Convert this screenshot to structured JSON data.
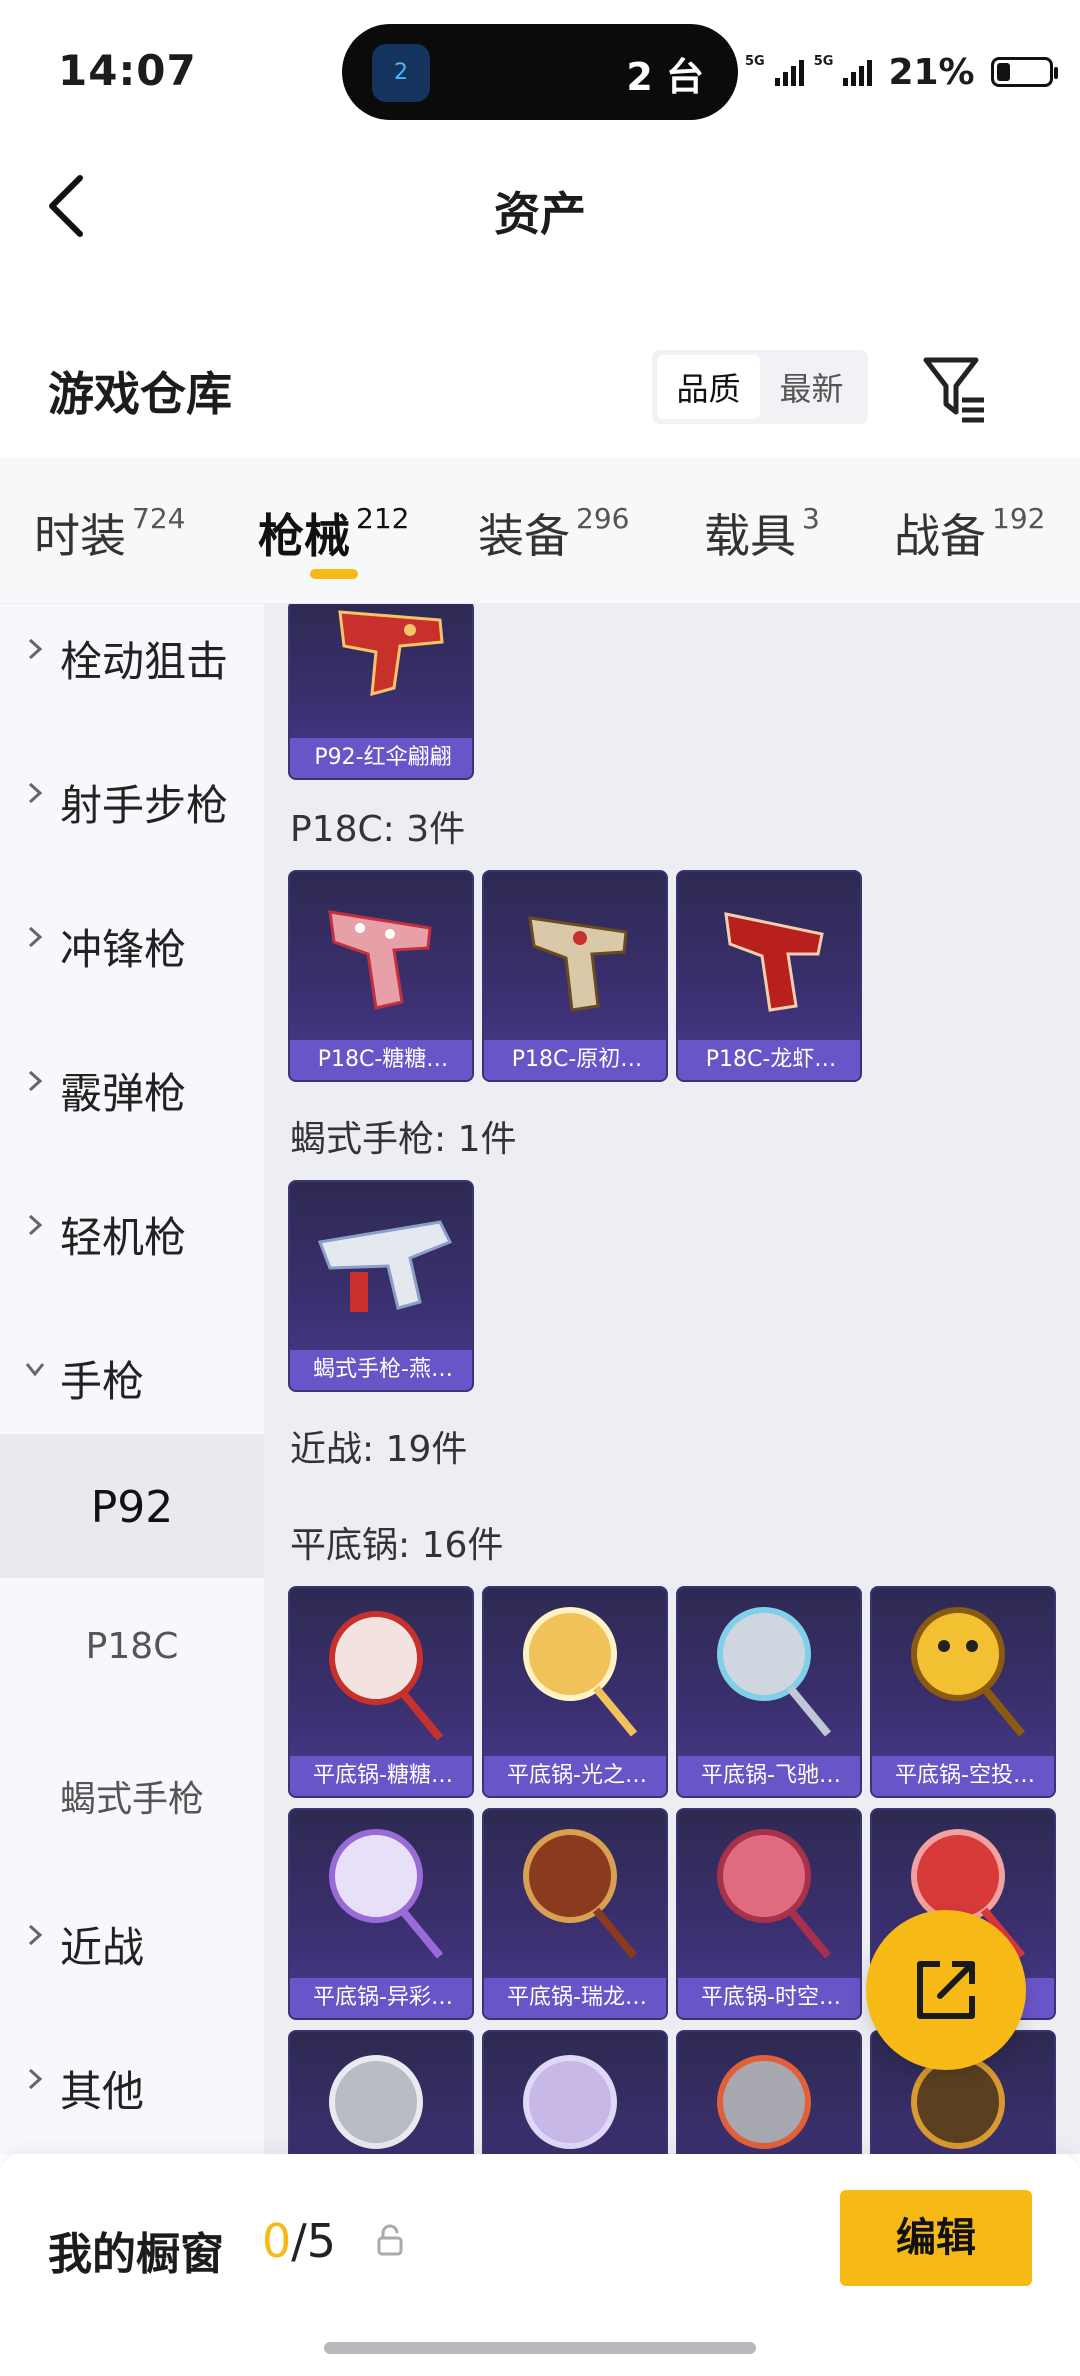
{
  "status_bar": {
    "time": "14:07",
    "island_badge": "2",
    "island_text": "2 台",
    "net1": "5G",
    "net2": "5G",
    "battery": "21%"
  },
  "header": {
    "title": "资产"
  },
  "warehouse": {
    "title": "游戏仓库",
    "sort_options": [
      "品质",
      "最新"
    ],
    "active_sort": "品质"
  },
  "tabs": [
    {
      "label": "时装",
      "count": "724"
    },
    {
      "label": "枪械",
      "count": "212"
    },
    {
      "label": "装备",
      "count": "296"
    },
    {
      "label": "载具",
      "count": "3"
    },
    {
      "label": "战备",
      "count": "192"
    }
  ],
  "active_tab": "枪械",
  "sidebar": {
    "items": [
      {
        "label": "栓动狙击"
      },
      {
        "label": "射手步枪"
      },
      {
        "label": "冲锋枪"
      },
      {
        "label": "霰弹枪"
      },
      {
        "label": "轻机枪"
      },
      {
        "label": "手枪"
      },
      {
        "label": "P92"
      },
      {
        "label": "P18C"
      },
      {
        "label": "蝎式手枪"
      },
      {
        "label": "近战"
      },
      {
        "label": "其他"
      }
    ]
  },
  "content": {
    "sections": [
      {
        "title": "P18C: 3件"
      },
      {
        "title": "蝎式手枪: 1件"
      },
      {
        "title": "近战: 19件"
      },
      {
        "title": "平底锅: 16件"
      }
    ],
    "p92_items": [
      "P92-红伞翩翩"
    ],
    "p18c_items": [
      "P18C-糖糖…",
      "P18C-原初…",
      "P18C-龙虾…"
    ],
    "scorpion_items": [
      "蝎式手枪-燕…"
    ],
    "pan_items": [
      "平底锅-糖糖…",
      "平底锅-光之…",
      "平底锅-飞驰…",
      "平底锅-空投…",
      "平底锅-异彩…",
      "平底锅-瑞龙…",
      "平底锅-时空…",
      ""
    ]
  },
  "bottom": {
    "window_label": "我的橱窗",
    "current": "0",
    "total": "/5",
    "edit_label": "编辑"
  },
  "colors": {
    "accent": "#f7b916",
    "card_bg": "#3a2f6e",
    "card_label": "#6a55c8"
  }
}
